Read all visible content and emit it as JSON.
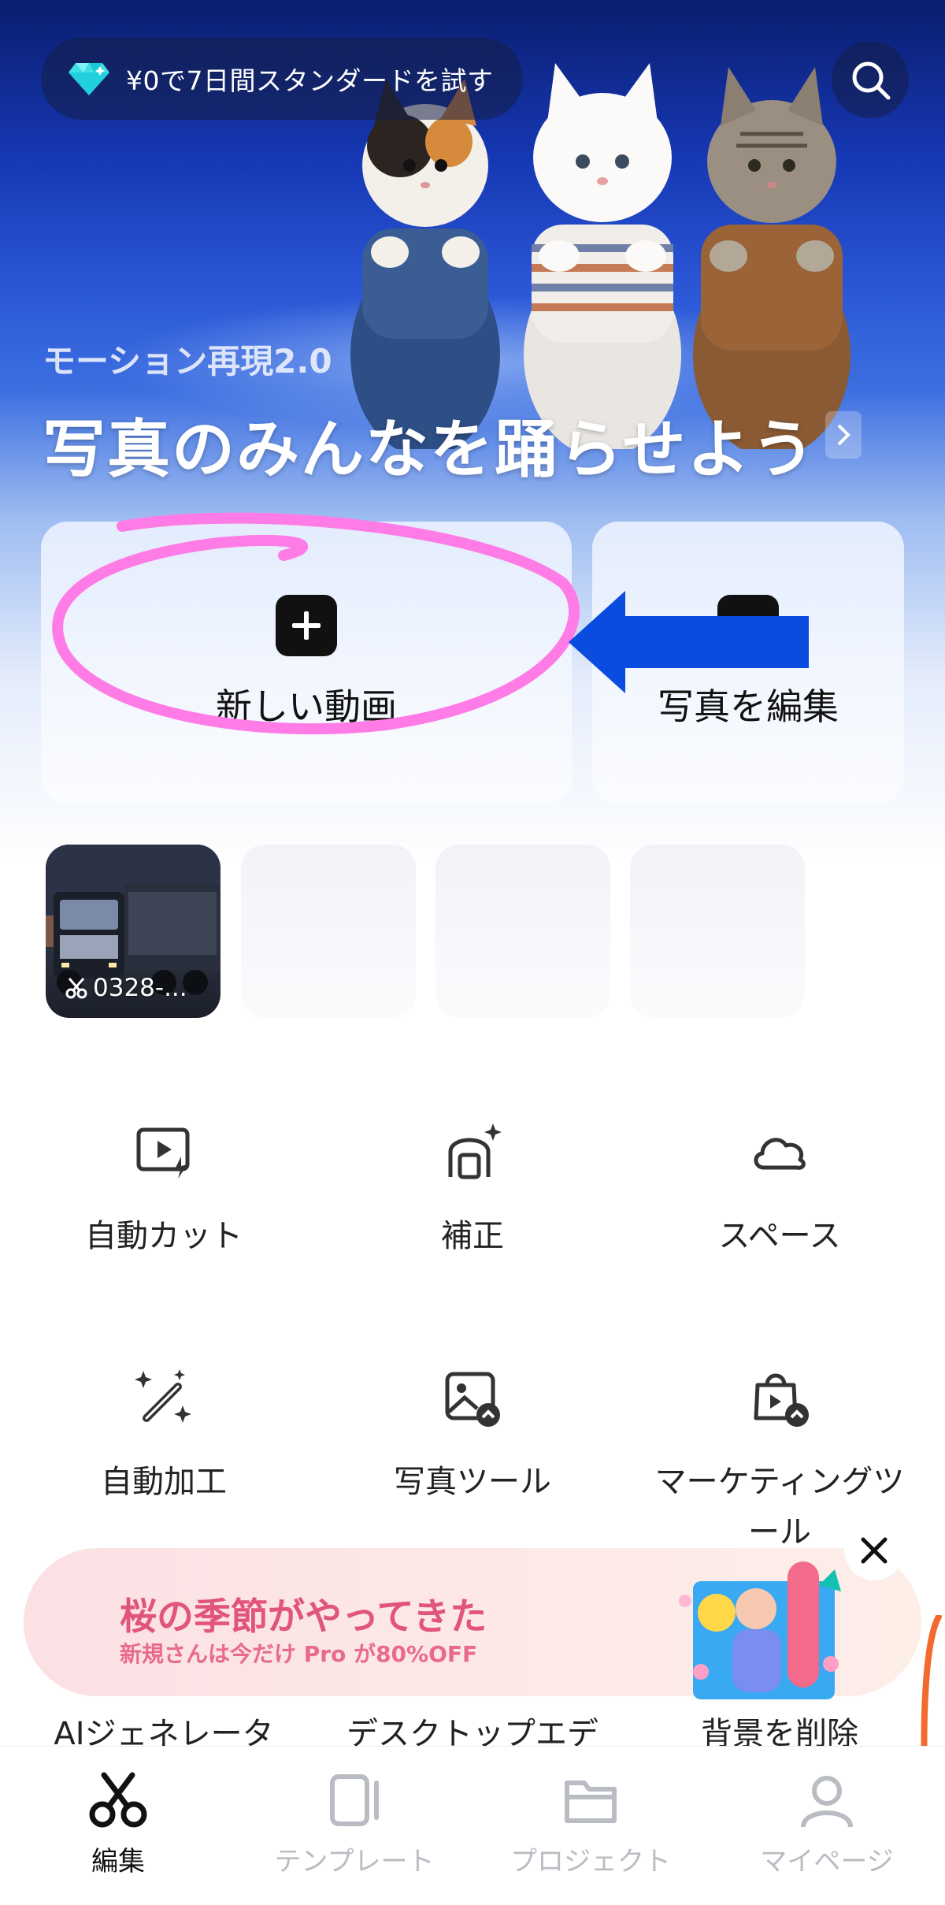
{
  "promo": {
    "text": "¥0で7日間スタンダードを試す",
    "icon": "diamond-icon"
  },
  "hero": {
    "subtitle": "モーション再現2.0",
    "title": "写真のみんなを踊らせよう"
  },
  "actions": {
    "new_video": "新しい動画",
    "edit_photo": "写真を編集"
  },
  "recent_projects": [
    {
      "label": "0328-..."
    }
  ],
  "tools": [
    {
      "label": "自動カット",
      "icon": "auto-cut-icon"
    },
    {
      "label": "補正",
      "icon": "retouch-icon"
    },
    {
      "label": "スペース",
      "icon": "cloud-space-icon"
    },
    {
      "label": "自動加工",
      "icon": "magic-wand-icon"
    },
    {
      "label": "写真ツール",
      "icon": "photo-tool-icon"
    },
    {
      "label": "マーケティングツ",
      "label2": "ール",
      "icon": "marketing-bag-icon"
    }
  ],
  "banner": {
    "title": "桜の季節がやってきた",
    "subtitle": "新規さんは今だけ Pro が80%OFF"
  },
  "more_tools": [
    "AIジェネレータ",
    "デスクトップエデ",
    "背景を削除"
  ],
  "tabs": [
    {
      "label": "編集",
      "active": true
    },
    {
      "label": "テンプレート",
      "active": false
    },
    {
      "label": "プロジェクト",
      "active": false
    },
    {
      "label": "マイページ",
      "active": false
    }
  ],
  "colors": {
    "accent": "#111111",
    "banner_pink": "#e2557b",
    "annotation_pink": "#ff7be6",
    "annotation_blue": "#0a4be0",
    "annotation_orange": "#f26a2e"
  }
}
